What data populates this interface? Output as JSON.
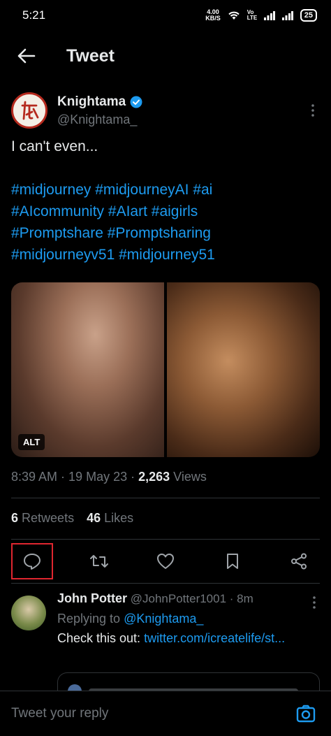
{
  "status_bar": {
    "time": "5:21",
    "net_speed_value": "4.00",
    "net_speed_unit": "KB/S",
    "volte": "Vo LTE",
    "battery": "25"
  },
  "header": {
    "title": "Tweet"
  },
  "author": {
    "name": "Knightama",
    "handle": "@Knightama_",
    "verified": true
  },
  "tweet": {
    "text": "I can't even...",
    "hashtags": [
      "#midjourney",
      "#midjourneyAI",
      "#ai",
      "#AIcommunity",
      "#AIart",
      "#aigirls",
      "#Promptshare",
      "#Promptsharing",
      "#midjourneyv51",
      "#midjourney51"
    ],
    "alt_badge": "ALT",
    "time": "8:39 AM",
    "date": "19 May 23",
    "views_count": "2,263",
    "views_label": "Views",
    "retweets_count": "6",
    "retweets_label": "Retweets",
    "likes_count": "46",
    "likes_label": "Likes"
  },
  "reply": {
    "name": "John Potter",
    "handle": "@JohnPotter1001",
    "time": "8m",
    "replying_prefix": "Replying to",
    "replying_to": "@Knightama_",
    "text": "Check this out:",
    "link": "twitter.com/icreatelife/st..."
  },
  "composer": {
    "placeholder": "Tweet your reply"
  },
  "colors": {
    "accent": "#1d9bf0",
    "highlight_box": "#e0262f",
    "muted": "#71767b"
  }
}
